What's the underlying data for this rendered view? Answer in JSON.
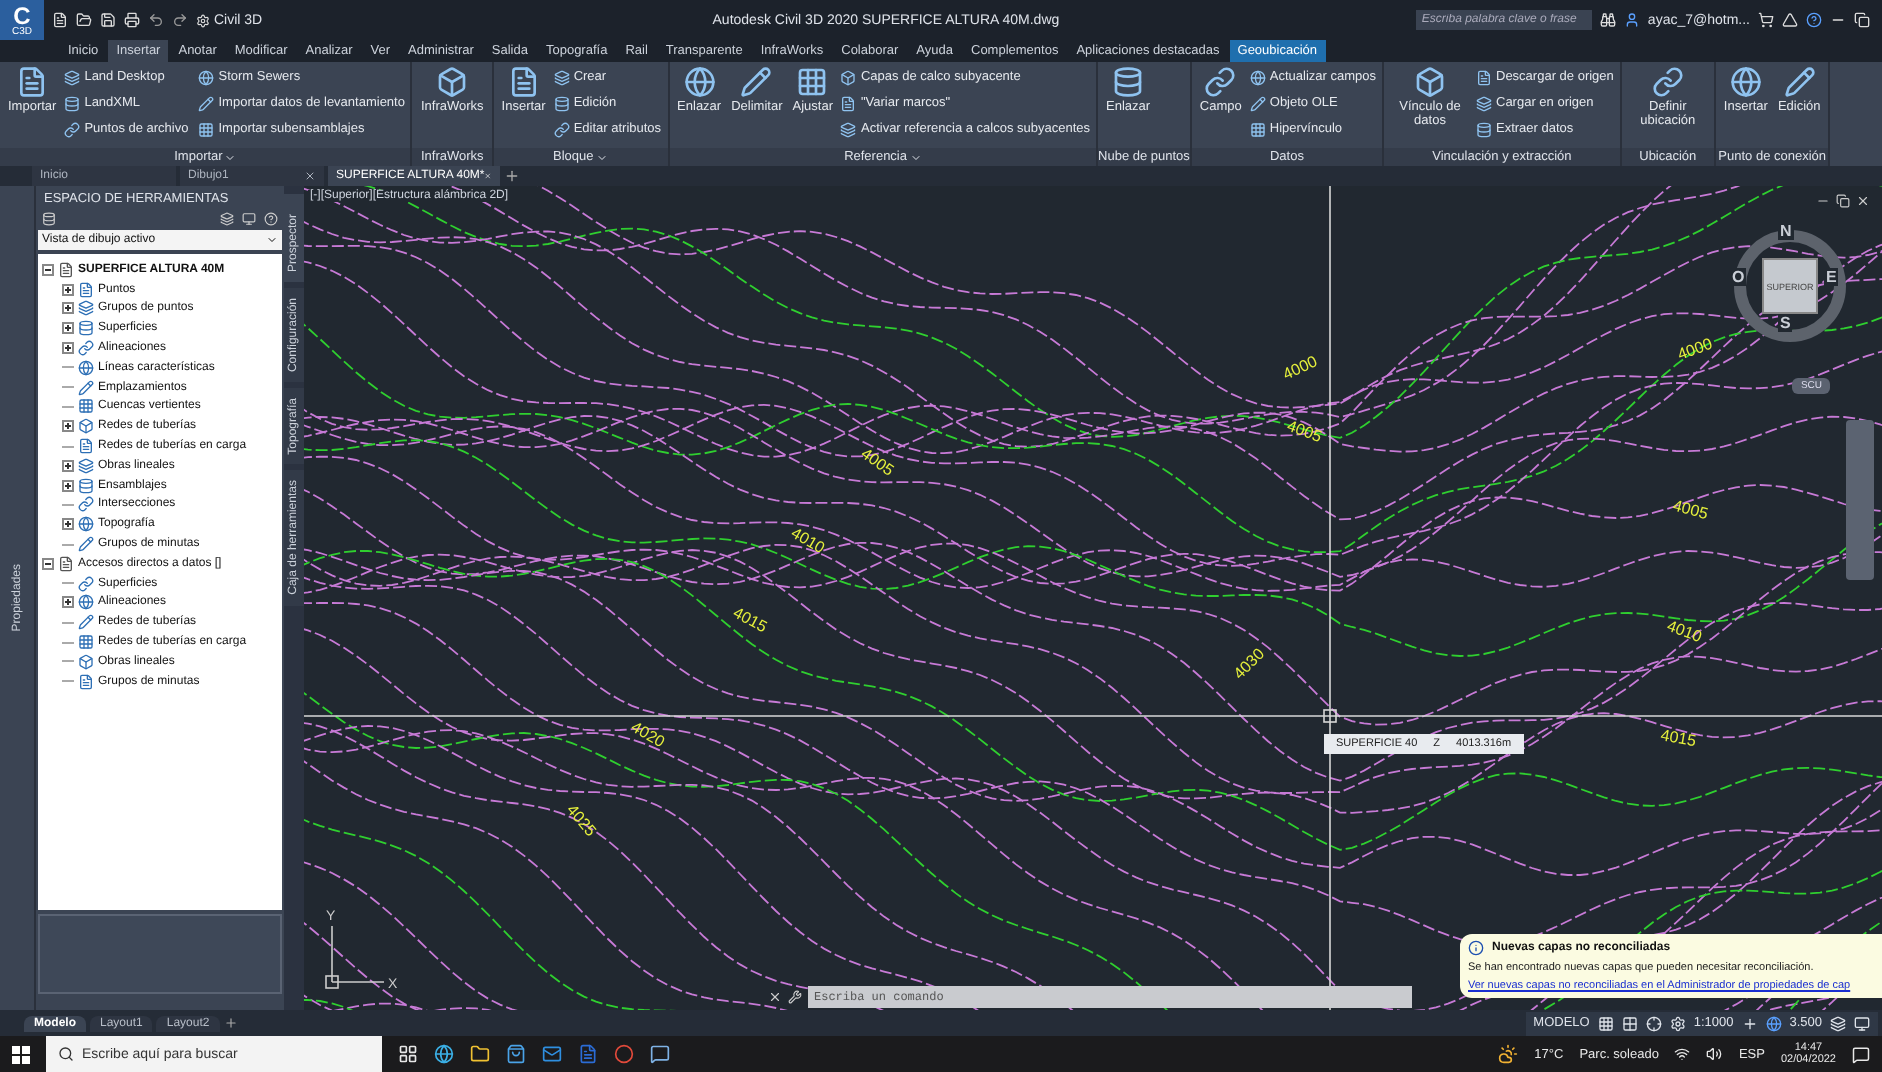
{
  "app": {
    "logo": "C",
    "logo_sub": "C3D",
    "workspace": "Civil 3D",
    "title": "Autodesk Civil 3D 2020   SUPERFICE ALTURA 40M.dwg",
    "search": {
      "placeholder": "Escriba palabra clave o frase"
    },
    "user": "ayac_7@hotm..."
  },
  "ribbon_tabs": [
    {
      "label": "Inicio",
      "selected": false,
      "contextual": false
    },
    {
      "label": "Insertar",
      "selected": true,
      "contextual": false
    },
    {
      "label": "Anotar",
      "selected": false,
      "contextual": false
    },
    {
      "label": "Modificar",
      "selected": false,
      "contextual": false
    },
    {
      "label": "Analizar",
      "selected": false,
      "contextual": false
    },
    {
      "label": "Ver",
      "selected": false,
      "contextual": false
    },
    {
      "label": "Administrar",
      "selected": false,
      "contextual": false
    },
    {
      "label": "Salida",
      "selected": false,
      "contextual": false
    },
    {
      "label": "Topografía",
      "selected": false,
      "contextual": false
    },
    {
      "label": "Rail",
      "selected": false,
      "contextual": false
    },
    {
      "label": "Transparente",
      "selected": false,
      "contextual": false
    },
    {
      "label": "InfraWorks",
      "selected": false,
      "contextual": false
    },
    {
      "label": "Colaborar",
      "selected": false,
      "contextual": false
    },
    {
      "label": "Ayuda",
      "selected": false,
      "contextual": false
    },
    {
      "label": "Complementos",
      "selected": false,
      "contextual": false
    },
    {
      "label": "Aplicaciones destacadas",
      "selected": false,
      "contextual": false
    },
    {
      "label": "Geoubicación",
      "selected": false,
      "contextual": true
    }
  ],
  "ribbon_groups": [
    {
      "label": "Importar",
      "menu": true,
      "large": [
        "Importar"
      ],
      "small": [
        "Land Desktop",
        "LandXML",
        "Puntos de archivo",
        "Storm Sewers",
        "Importar datos de levantamiento",
        "Importar subensamblajes"
      ]
    },
    {
      "label": "InfraWorks",
      "menu": false,
      "large": [
        "InfraWorks"
      ]
    },
    {
      "label": "Bloque",
      "menu": true,
      "large": [
        "Insertar"
      ],
      "small": [
        "Crear",
        "Edición",
        "Editar atributos"
      ]
    },
    {
      "label": "Referencia",
      "menu": true,
      "large": [
        "Enlazar",
        "Delimitar",
        "Ajustar"
      ],
      "small": [
        "Capas de calco subyacente",
        "\"Variar marcos\"",
        "Activar referencia a calcos subyacentes"
      ]
    },
    {
      "label": "Nube de puntos",
      "menu": false,
      "large": [
        "Enlazar"
      ]
    },
    {
      "label": "Datos",
      "menu": false,
      "large": [
        "Campo"
      ],
      "small": [
        "Actualizar campos",
        "Objeto OLE",
        "Hipervínculo"
      ]
    },
    {
      "label": "Vinculación y extracción",
      "menu": false,
      "large": [
        "Vínculo de datos"
      ],
      "small": [
        "Descargar de origen",
        "Cargar en origen",
        "Extraer  datos"
      ]
    },
    {
      "label": "Ubicación",
      "menu": false,
      "large": [
        "Definir ubicación"
      ]
    },
    {
      "label": "Punto de conexión",
      "menu": false,
      "large": [
        "Insertar",
        "Edición"
      ]
    }
  ],
  "doc_tabs": [
    {
      "label": "Inicio",
      "selected": false,
      "closable": false
    },
    {
      "label": "Dibujo1",
      "selected": false,
      "closable": true
    },
    {
      "label": "SUPERFICE ALTURA 40M*",
      "selected": true,
      "closable": true
    }
  ],
  "side_strip": {
    "label": "Propiedades"
  },
  "toolspace": {
    "title": "ESPACIO DE HERRAMIENTAS",
    "view": "Vista de dibujo activo",
    "tree": [
      {
        "label": "SUPERFICE ALTURA 40M",
        "expanded": true,
        "children": [
          {
            "label": "Puntos",
            "expandable": true
          },
          {
            "label": "Grupos de puntos",
            "expandable": true
          },
          {
            "label": "Superficies",
            "expandable": true
          },
          {
            "label": "Alineaciones",
            "expandable": true
          },
          {
            "label": "Líneas características",
            "expandable": false
          },
          {
            "label": "Emplazamientos",
            "expandable": false
          },
          {
            "label": "Cuencas vertientes",
            "expandable": false
          },
          {
            "label": "Redes de tuberías",
            "expandable": true
          },
          {
            "label": "Redes de tuberías en carga",
            "expandable": false
          },
          {
            "label": "Obras lineales",
            "expandable": true
          },
          {
            "label": "Ensamblajes",
            "expandable": true
          },
          {
            "label": "Intersecciones",
            "expandable": false
          },
          {
            "label": "Topografía",
            "expandable": true
          },
          {
            "label": "Grupos de minutas",
            "expandable": false
          }
        ]
      },
      {
        "label": "Accesos directos a datos []",
        "expanded": true,
        "children": [
          {
            "label": "Superficies",
            "expandable": false
          },
          {
            "label": "Alineaciones",
            "expandable": true
          },
          {
            "label": "Redes de tuberías",
            "expandable": false
          },
          {
            "label": "Redes de tuberías en carga",
            "expandable": false
          },
          {
            "label": "Obras lineales",
            "expandable": false
          },
          {
            "label": "Grupos de minutas",
            "expandable": false
          }
        ]
      }
    ]
  },
  "vertical_tabs": [
    {
      "label": "Prospector",
      "selected": true
    },
    {
      "label": "Configuración",
      "selected": false
    },
    {
      "label": "Topografía",
      "selected": false
    },
    {
      "label": "Caja de herramientas",
      "selected": false
    }
  ],
  "viewport": {
    "label": "[-][Superior][Estructura alámbrica 2D]",
    "contour_labels": [
      "4005",
      "4010",
      "4015",
      "4020",
      "4025",
      "4000",
      "4005",
      "4030",
      "4000",
      "4005",
      "4010",
      "4015"
    ],
    "viewcube": {
      "north": "N",
      "south": "S",
      "east": "E",
      "west": "O",
      "face": "SUPERIOR",
      "ucs": "SCU"
    },
    "axes": {
      "x": "X",
      "y": "Y"
    },
    "tooltip": {
      "name": "SUPERFICIE 40",
      "axis": "Z",
      "value": "4013.316m"
    },
    "command": {
      "placeholder": "Escriba un comando"
    },
    "notice": {
      "title": "Nuevas capas no reconciliadas",
      "text": "Se han encontrado nuevas capas que pueden necesitar reconciliación.",
      "link": "Ver nuevas capas no reconciliadas en el Administrador de propiedades de cap"
    }
  },
  "layout_tabs": [
    {
      "label": "Modelo",
      "selected": true
    },
    {
      "label": "Layout1",
      "selected": false
    },
    {
      "label": "Layout2",
      "selected": false
    }
  ],
  "status_bar": {
    "mode": "MODELO",
    "scale": "1:1000",
    "annotation": "3.500"
  },
  "taskbar": {
    "search": {
      "placeholder": "Escribe aquí para buscar"
    },
    "weather": "17°C",
    "condition": "Parc. soleado",
    "language": "ESP",
    "time": "14:47",
    "date": "02/04/2022"
  }
}
